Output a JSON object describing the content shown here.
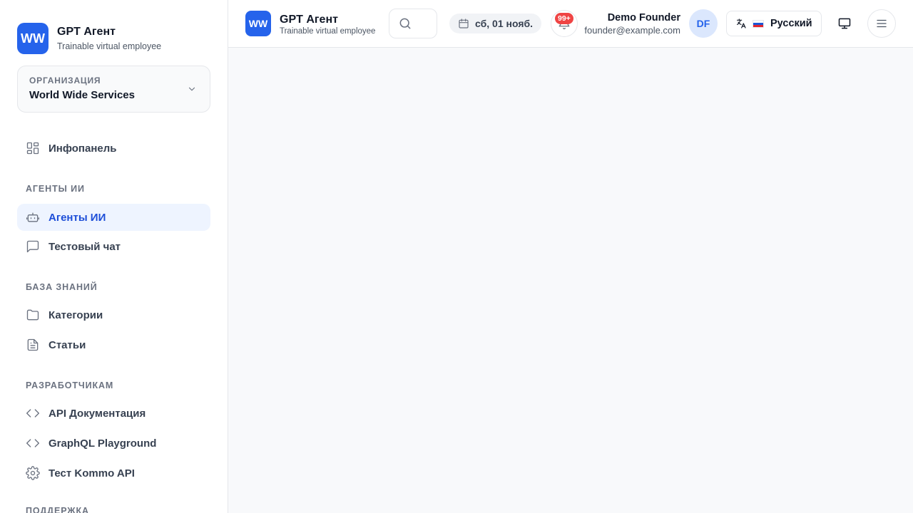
{
  "brand": {
    "logo_text": "WW",
    "title": "GPT Агент",
    "subtitle": "Trainable virtual employee"
  },
  "org": {
    "label": "ОРГАНИЗАЦИЯ",
    "value": "World Wide Services"
  },
  "sidebar": {
    "dashboard": {
      "label": "Инфопанель",
      "icon": "grid-icon"
    },
    "sections": [
      {
        "title": "АГЕНТЫ ИИ",
        "items": [
          {
            "label": "Агенты ИИ",
            "icon": "robot-icon",
            "active": true
          },
          {
            "label": "Тестовый чат",
            "icon": "chat-icon",
            "active": false
          }
        ]
      },
      {
        "title": "БАЗА ЗНАНИЙ",
        "items": [
          {
            "label": "Категории",
            "icon": "folder-icon",
            "active": false
          },
          {
            "label": "Статьи",
            "icon": "document-icon",
            "active": false
          }
        ]
      },
      {
        "title": "РАЗРАБОТЧИКАМ",
        "items": [
          {
            "label": "API Документация",
            "icon": "code-icon",
            "active": false
          },
          {
            "label": "GraphQL Playground",
            "icon": "code-icon",
            "active": false
          },
          {
            "label": "Тест Kommo API",
            "icon": "gear-icon",
            "active": false
          }
        ]
      },
      {
        "title": "ПОДДЕРЖКА",
        "items": []
      }
    ]
  },
  "topbar": {
    "logo_text": "WW",
    "title": "GPT Агент",
    "subtitle": "Trainable virtual employee",
    "date": "сб, 01 нояб.",
    "notifications_badge": "99+",
    "user_name": "Demo Founder",
    "user_email": "founder@example.com",
    "avatar_initials": "DF",
    "language": "Русский"
  },
  "colors": {
    "accent": "#2563eb",
    "active_bg": "#eef4ff",
    "badge": "#ef4444"
  }
}
